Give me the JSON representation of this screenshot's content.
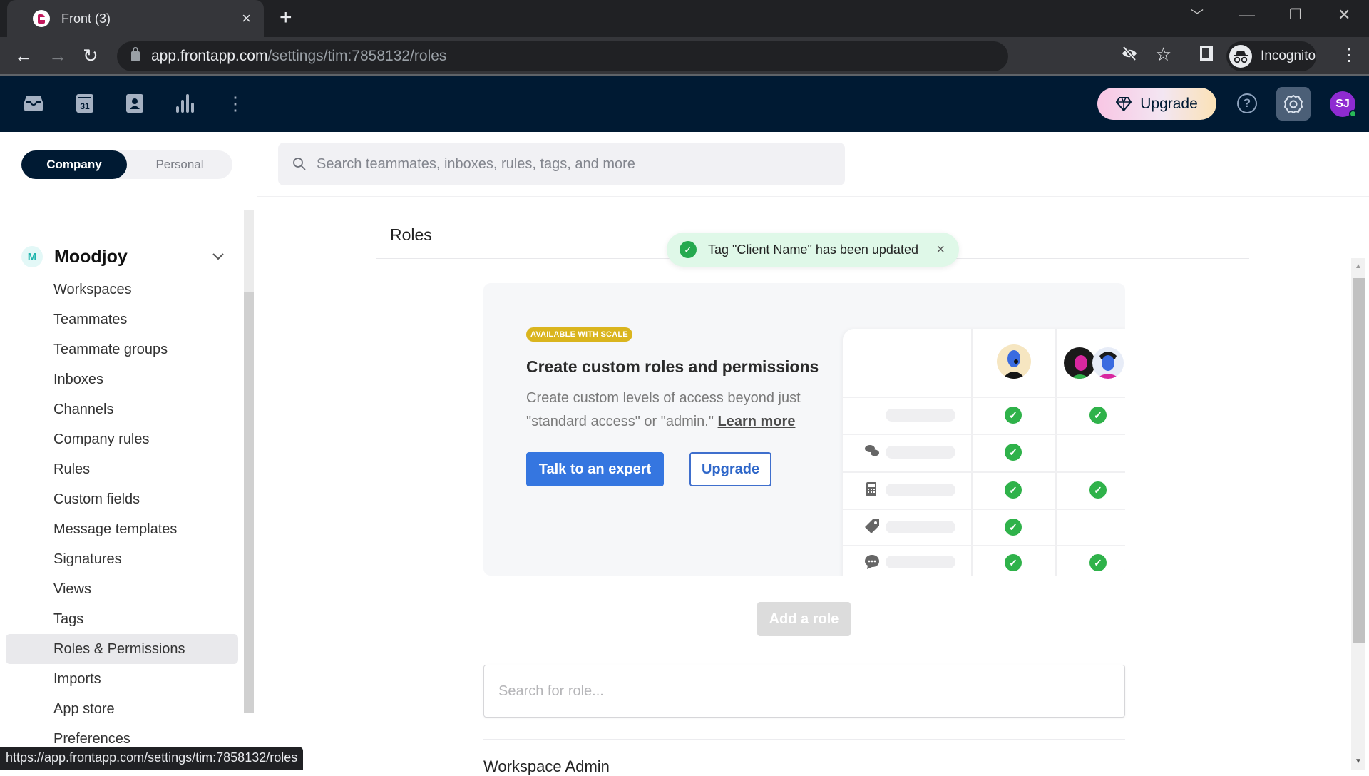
{
  "browser": {
    "tab_title": "Front (3)",
    "tab_close": "×",
    "new_tab": "+",
    "url_host": "app.frontapp.com",
    "url_path": "/settings/tim:7858132/roles",
    "profile_label": "Incognito",
    "status_url": "https://app.frontapp.com/settings/tim:7858132/roles",
    "icons": [
      "back-icon",
      "forward-icon",
      "reload-icon",
      "lock-icon",
      "eye-off-icon",
      "star-icon",
      "side-panel-icon",
      "incognito-icon",
      "kebab-menu-icon"
    ]
  },
  "appbar": {
    "icons": [
      "inbox-icon",
      "calendar-icon",
      "contacts-icon",
      "analytics-icon",
      "more-icon"
    ],
    "calendar_day": "31",
    "upgrade_label": "Upgrade",
    "help_glyph": "?",
    "avatar_initials": "SJ",
    "colors": {
      "bg": "#001a33",
      "avatar": "#8e2bd1",
      "online": "#28b957"
    }
  },
  "sidebar": {
    "scope_tabs": [
      {
        "label": "Company",
        "active": true
      },
      {
        "label": "Personal",
        "active": false
      }
    ],
    "org_initial": "M",
    "org_name": "Moodjoy",
    "items": [
      {
        "label": "Workspaces"
      },
      {
        "label": "Teammates"
      },
      {
        "label": "Teammate groups"
      },
      {
        "label": "Inboxes"
      },
      {
        "label": "Channels"
      },
      {
        "label": "Company rules"
      },
      {
        "label": "Rules"
      },
      {
        "label": "Custom fields"
      },
      {
        "label": "Message templates"
      },
      {
        "label": "Signatures"
      },
      {
        "label": "Views"
      },
      {
        "label": "Tags"
      },
      {
        "label": "Roles & Permissions",
        "active": true
      },
      {
        "label": "Imports"
      },
      {
        "label": "App store"
      },
      {
        "label": "Preferences"
      }
    ]
  },
  "main": {
    "search_placeholder": "Search teammates, inboxes, rules, tags, and more",
    "page_title": "Roles",
    "toast": {
      "message": "Tag \"Client Name\" has been updated",
      "close": "×"
    },
    "promo": {
      "badge": "AVAILABLE WITH SCALE",
      "title": "Create custom roles and permissions",
      "description": "Create custom levels of access beyond just \"standard access\" or \"admin.\"",
      "learn_more": "Learn more",
      "primary_button": "Talk to an expert",
      "secondary_button": "Upgrade",
      "matrix": {
        "row_icons": [
          "none",
          "chat-bubbles-icon",
          "phone-icon",
          "tag-icon",
          "comment-icon"
        ],
        "column_1_checks": [
          true,
          true,
          true,
          true,
          true
        ],
        "column_2_checks": [
          true,
          false,
          true,
          false,
          true
        ]
      },
      "colors": {
        "badge": "#dab51e",
        "primary": "#3576e0",
        "check": "#2fb24a"
      }
    },
    "add_role_button": "Add a role",
    "role_search_placeholder": "Search for role...",
    "first_role": "Workspace Admin"
  }
}
